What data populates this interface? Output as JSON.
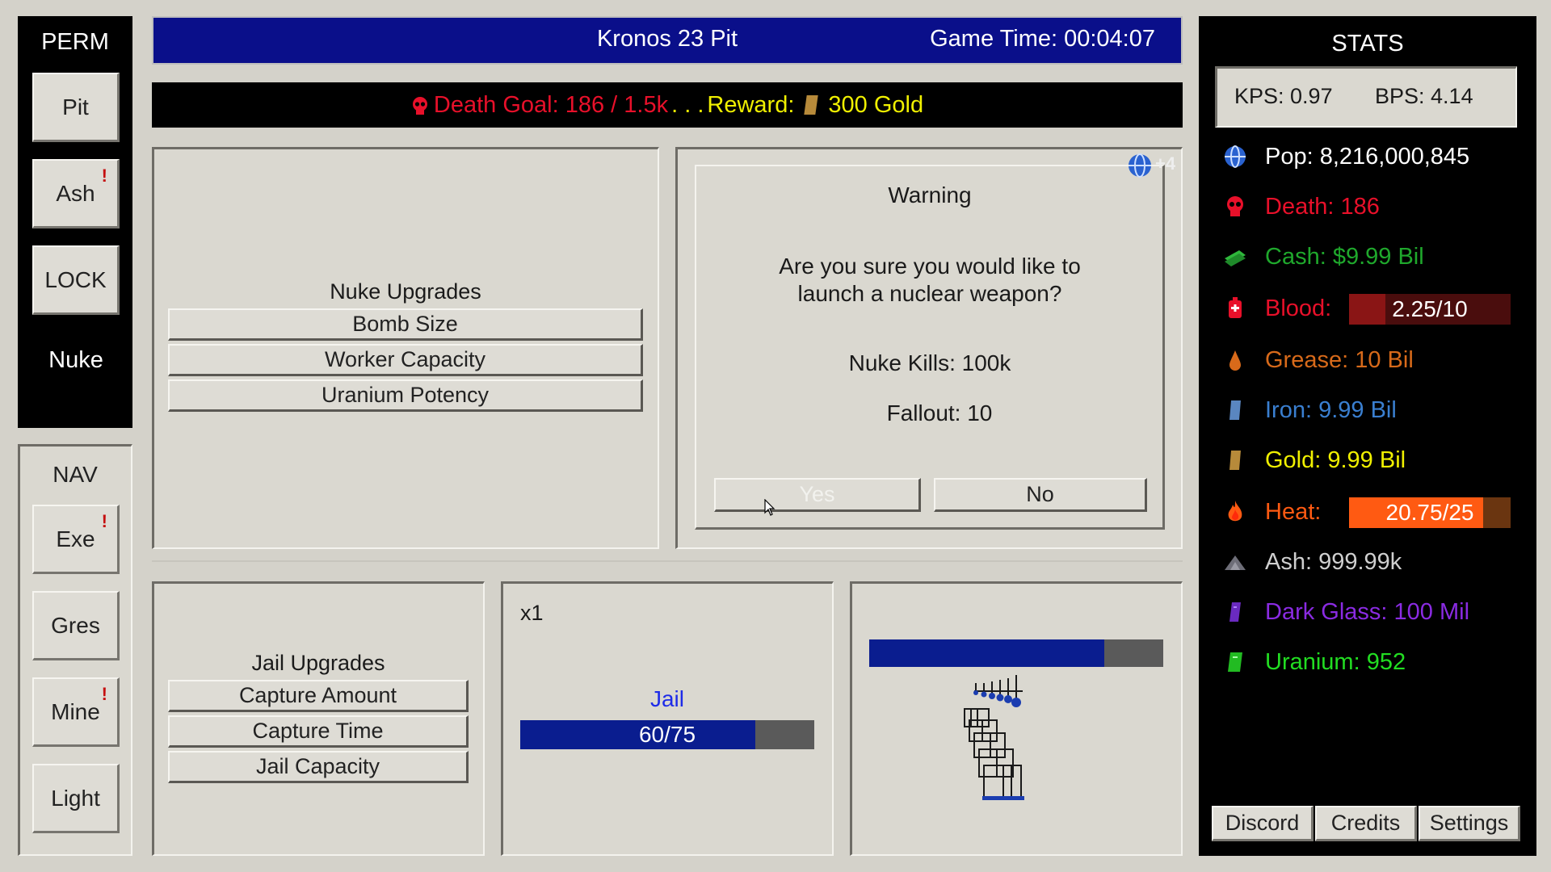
{
  "perm": {
    "title": "PERM",
    "items": [
      "Pit",
      "Ash",
      "LOCK",
      "Nuke"
    ]
  },
  "nav": {
    "title": "NAV",
    "items": [
      "Exe",
      "Gres",
      "Mine",
      "Light"
    ]
  },
  "header": {
    "location": "Kronos 23 Pit",
    "game_time": "Game Time: 00:04:07"
  },
  "goal": {
    "death_goal": "Death Goal: 186 / 1.5k",
    "dots": ". . .",
    "reward_label": "Reward:",
    "reward_value": "300 Gold"
  },
  "nuke_upgrades": {
    "title": "Nuke Upgrades",
    "items": [
      "Bomb Size",
      "Worker Capacity",
      "Uranium Potency"
    ]
  },
  "dialog": {
    "title": "Warning",
    "message_line1": "Are you sure you would like to",
    "message_line2": "launch a nuclear weapon?",
    "nuke_kills": "Nuke Kills: 100k",
    "fallout": "Fallout: 10",
    "yes_label": "Yes",
    "no_label": "No",
    "badge": "+4"
  },
  "jail_upgrades": {
    "title": "Jail Upgrades",
    "items": [
      "Capture Amount",
      "Capture Time",
      "Jail Capacity"
    ]
  },
  "jail": {
    "multiplier": "x1",
    "label": "Jail",
    "progress_text": "60/75",
    "progress": 0.8
  },
  "scene": {
    "progress": 0.8
  },
  "stats": {
    "title": "STATS",
    "kps": "KPS: 0.97",
    "bps": "BPS: 4.14",
    "pop": "Pop: 8,216,000,845",
    "death": "Death: 186",
    "cash": "Cash: $9.99 Bil",
    "blood_label": "Blood:",
    "blood_value": "2.25/10",
    "blood_fraction": 0.225,
    "grease": "Grease: 10 Bil",
    "iron": "Iron: 9.99 Bil",
    "gold": "Gold: 9.99 Bil",
    "heat_label": "Heat:",
    "heat_value": "20.75/25",
    "heat_fraction": 0.83,
    "ash": "Ash: 999.99k",
    "dark_glass": "Dark Glass: 100 Mil",
    "uranium": "Uranium: 952"
  },
  "footer": {
    "discord": "Discord",
    "credits": "Credits",
    "settings": "Settings"
  },
  "colors": {
    "header_blue": "#0a0f8a",
    "death_red": "#e8102a",
    "reward_yellow": "#f0f000",
    "cash_green": "#1fa82c",
    "iron_blue": "#3a7fd0",
    "grease_orange": "#d86a1a",
    "heat_orange": "#ff5a12",
    "blood_red": "#8a1515",
    "dark_glass_purple": "#8a2be2",
    "uranium_green": "#22dd22",
    "progress_blue": "#0a1d8f"
  }
}
